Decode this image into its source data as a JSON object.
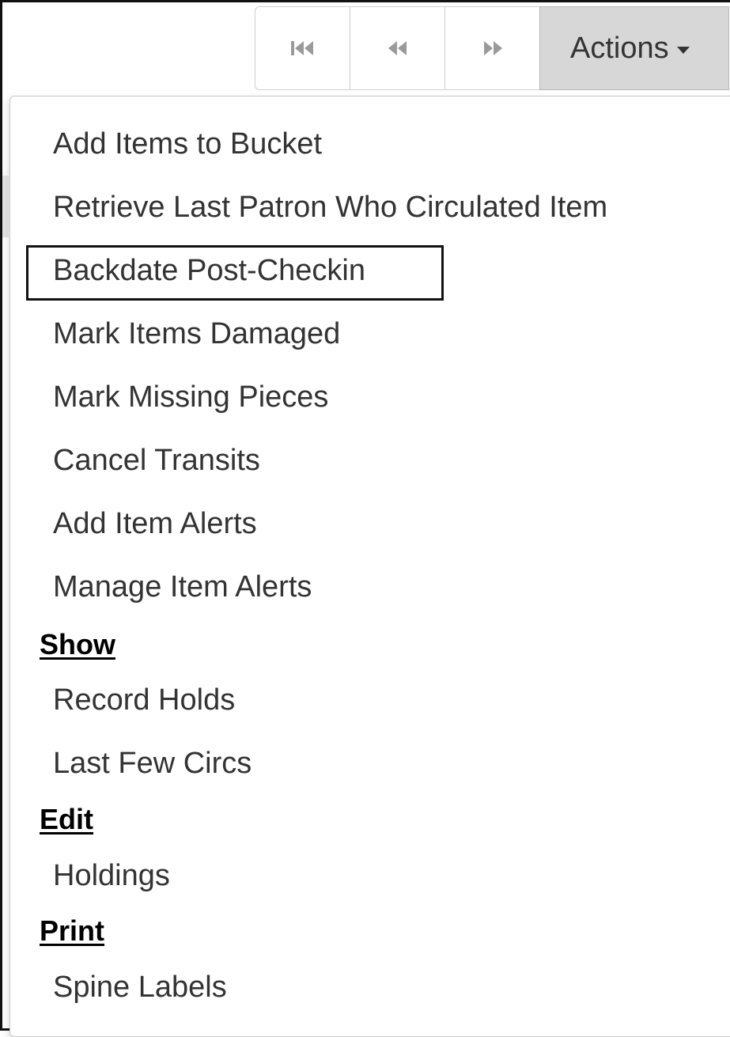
{
  "toolbar": {
    "first_icon": "first-page-icon",
    "prev_icon": "previous-page-icon",
    "next_icon": "next-page-icon",
    "actions_label": "Actions"
  },
  "menu": {
    "items": [
      "Add Items to Bucket",
      "Retrieve Last Patron Who Circulated Item",
      "Backdate Post-Checkin",
      "Mark Items Damaged",
      "Mark Missing Pieces",
      "Cancel Transits",
      "Add Item Alerts",
      "Manage Item Alerts"
    ],
    "show_header": "Show",
    "show_items": [
      "Record Holds",
      "Last Few Circs"
    ],
    "edit_header": "Edit",
    "edit_items": [
      "Holdings"
    ],
    "print_header": "Print",
    "print_items": [
      "Spine Labels"
    ]
  }
}
